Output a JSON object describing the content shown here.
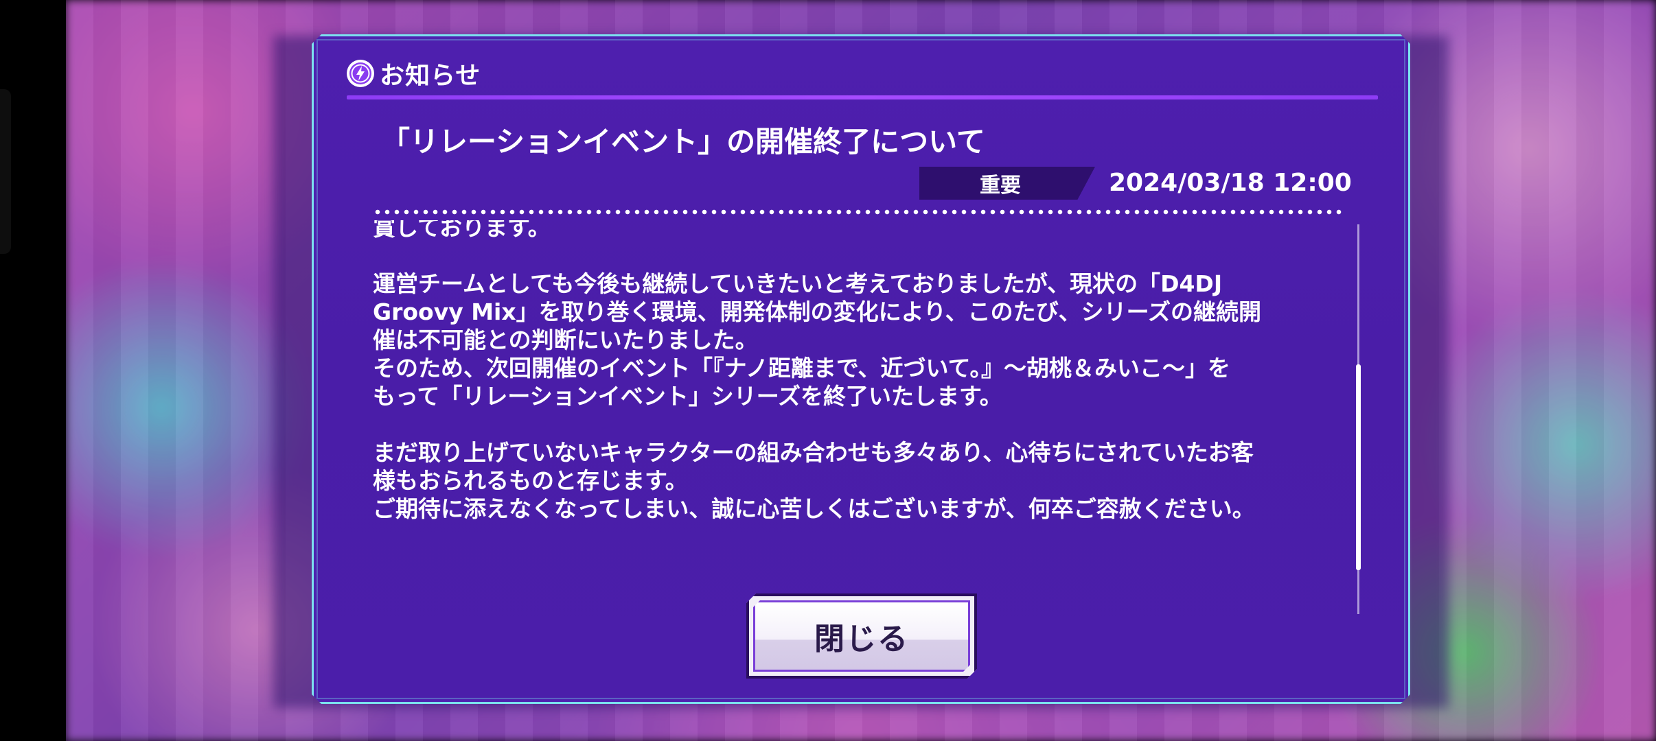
{
  "dialog": {
    "header_title": "お知らせ",
    "notice_title": "「リレーションイベント」の開催終了について",
    "tag_label": "重要",
    "date": "2024/03/18 12:00",
    "close_label": "閉じる",
    "scroll_position": 0.62,
    "body": {
      "partial_line": "賞しております。",
      "para1_line1": "運営チームとしても今後も継続していきたいと考えておりましたが、現状の「D4DJ",
      "para1_line2": "Groovy Mix」を取り巻く環境、開発体制の変化により、このたび、シリーズの継続開",
      "para1_line3": "催は不可能との判断にいたりました。",
      "para1_line4": "そのため、次回開催のイベント「『ナノ距離まで、近づいて。』～胡桃＆みいこ～」を",
      "para1_line5": "もって「リレーションイベント」シリーズを終了いたします。",
      "para2_line1": "まだ取り上げていないキャラクターの組み合わせも多々あり、心待ちにされていたお客",
      "para2_line2": "様もおられるものと存じます。",
      "para2_line3": "ご期待に添えなくなってしまい、誠に心苦しくはございますが、何卒ご容赦ください。"
    }
  },
  "colors": {
    "panel": "#4b1eaa",
    "border_accent": "#7ce1ee",
    "header_line": "#9a44fb",
    "tag_bg": "#2e0f6e",
    "button_border": "#7a3fd8"
  },
  "icons": {
    "header_icon": "lightning-bolt-icon"
  }
}
